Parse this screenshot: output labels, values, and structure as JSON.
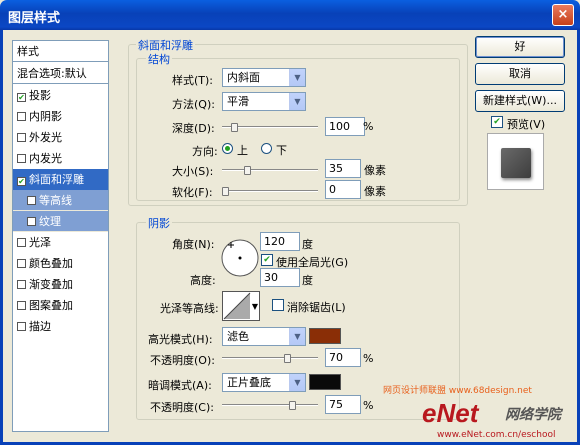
{
  "window": {
    "title": "图层样式",
    "close": "×"
  },
  "left_panel": {
    "header": "样式",
    "blend_options": "混合选项:默认",
    "items": [
      {
        "label": "投影",
        "checked": true
      },
      {
        "label": "内阴影",
        "checked": false
      },
      {
        "label": "外发光",
        "checked": false
      },
      {
        "label": "内发光",
        "checked": false
      },
      {
        "label": "斜面和浮雕",
        "checked": true,
        "selected": true
      },
      {
        "label": "等高线",
        "checked": false,
        "sub": true
      },
      {
        "label": "纹理",
        "checked": false,
        "sub": true
      },
      {
        "label": "光泽",
        "checked": false
      },
      {
        "label": "颜色叠加",
        "checked": false
      },
      {
        "label": "渐变叠加",
        "checked": false
      },
      {
        "label": "图案叠加",
        "checked": false
      },
      {
        "label": "描边",
        "checked": false
      }
    ]
  },
  "bevel": {
    "group_title": "斜面和浮雕",
    "structure_title": "结构",
    "style_label": "样式(T):",
    "style_value": "内斜面",
    "technique_label": "方法(Q):",
    "technique_value": "平滑",
    "depth_label": "深度(D):",
    "depth_value": "100",
    "depth_unit": "%",
    "depth_level": 0.1,
    "direction_label": "方向:",
    "direction_up": "上",
    "direction_down": "下",
    "size_label": "大小(S):",
    "size_value": "35",
    "size_unit": "像素",
    "size_level": 0.25,
    "soften_label": "软化(F):",
    "soften_value": "0",
    "soften_unit": "像素",
    "soften_level": 0.0
  },
  "shading": {
    "title": "阴影",
    "angle_label": "角度(N):",
    "angle_value": "120",
    "angle_unit": "度",
    "global_light": "使用全局光(G)",
    "altitude_label": "高度:",
    "altitude_value": "30",
    "altitude_unit": "度",
    "gloss_label": "光泽等高线:",
    "anti_alias": "消除锯齿(L)",
    "highlight_label": "高光模式(H):",
    "highlight_mode": "滤色",
    "highlight_color": "#8a2e06",
    "opacity1_label": "不透明度(O):",
    "opacity1_value": "70",
    "opacity1_level": 0.7,
    "shadow_label": "暗调模式(A):",
    "shadow_mode": "正片叠底",
    "shadow_color": "#0a0a0a",
    "opacity2_label": "不透明度(C):",
    "opacity2_value": "75",
    "opacity2_level": 0.75,
    "pct": "%"
  },
  "buttons": {
    "ok": "好",
    "cancel": "取消",
    "new_style": "新建样式(W)...",
    "preview": "预览(V)"
  },
  "watermark": {
    "line1": "网页设计师联盟  www.68design.net",
    "logo": "eNet",
    "logo_cn": "网络学院",
    "url": "www.eNet.com.cn/eschool"
  }
}
